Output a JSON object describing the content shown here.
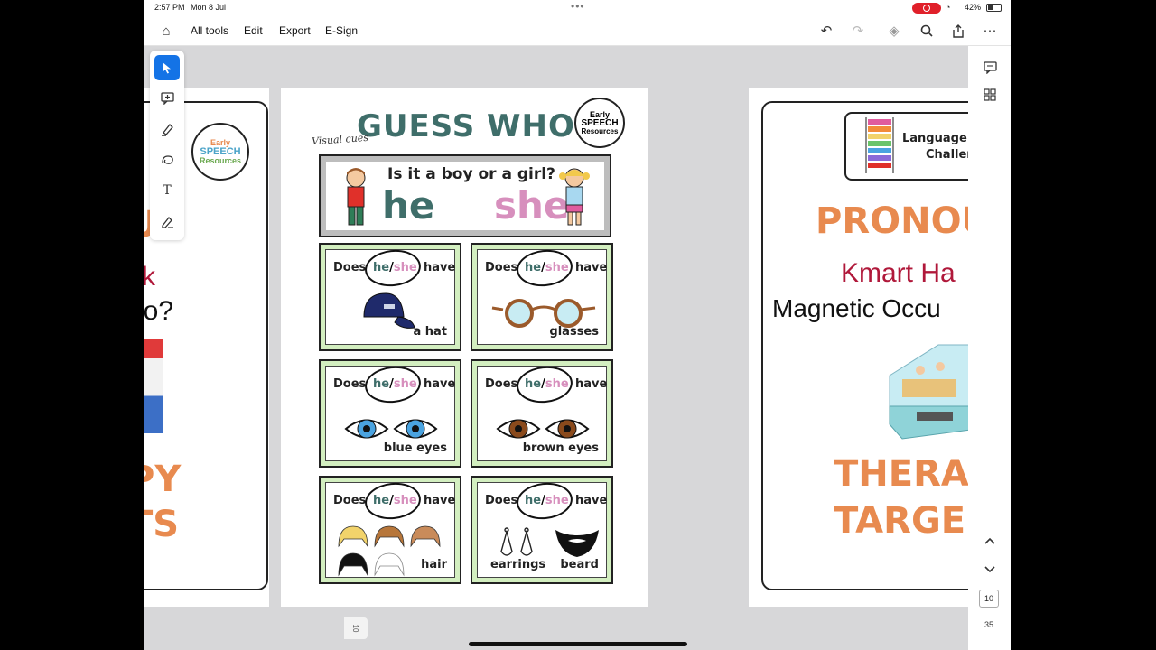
{
  "status": {
    "time": "2:57 PM",
    "date": "Mon 8 Jul",
    "battery": "42%"
  },
  "toolbar": {
    "all_tools": "All tools",
    "edit": "Edit",
    "export": "Export",
    "esign": "E-Sign"
  },
  "pagination": {
    "current": "10",
    "total": "35",
    "thumb": "10"
  },
  "left_page": {
    "big1": "US",
    "line1": "ck",
    "line2": "ho?",
    "big2": "PY",
    "big3": "TS",
    "logo": {
      "early": "Early",
      "speech": "SPEECH",
      "resources": "Resources"
    }
  },
  "center_page": {
    "visual_cues": "Visual cues",
    "title": "GUESS WHO",
    "logo": {
      "early": "Early",
      "speech": "SPEECH",
      "resources": "Resources"
    },
    "banner": {
      "question": "Is it a boy or a girl?",
      "he": "he",
      "she": "she"
    },
    "card_words": {
      "does": "Does",
      "he": "he",
      "slash": "/",
      "she": "she",
      "have": "have"
    },
    "cards": {
      "hat": "a hat",
      "glasses": "glasses",
      "blue_eyes": "blue eyes",
      "brown_eyes": "brown eyes",
      "hair": "hair",
      "earrings": "earrings",
      "beard": "beard"
    },
    "colors": {
      "teal": "#3f6e6a",
      "pink": "#d78fbd",
      "card_green": "#d3efc0"
    }
  },
  "right_page": {
    "badge_line1": "Language T",
    "badge_line2": "Challen",
    "big1": "PRONOU",
    "kmart": "Kmart Ha",
    "line2": "Magnetic Occu",
    "big2": "THERA",
    "big3": "TARGE"
  },
  "accent_color": "#e88a4f"
}
